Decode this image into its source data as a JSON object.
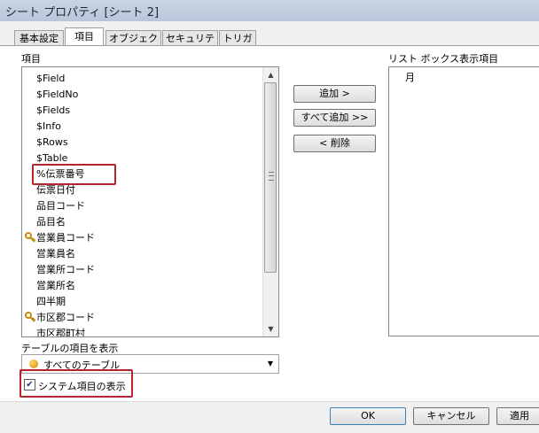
{
  "window": {
    "title": "シート プロパティ [シート 2]"
  },
  "tabs": [
    {
      "label": "基本設定",
      "active": false
    },
    {
      "label": "項目",
      "active": true
    },
    {
      "label": "オブジェクト",
      "active": false
    },
    {
      "label": "セキュリティ",
      "active": false
    },
    {
      "label": "トリガー",
      "active": false
    }
  ],
  "fields_panel": {
    "label": "項目",
    "items": [
      {
        "text": "$Field",
        "icon": ""
      },
      {
        "text": "$FieldNo",
        "icon": ""
      },
      {
        "text": "$Fields",
        "icon": ""
      },
      {
        "text": "$Info",
        "icon": ""
      },
      {
        "text": "$Rows",
        "icon": ""
      },
      {
        "text": "$Table",
        "icon": ""
      },
      {
        "text": "%伝票番号",
        "icon": ""
      },
      {
        "text": "伝票日付",
        "icon": ""
      },
      {
        "text": "品目コード",
        "icon": ""
      },
      {
        "text": "品目名",
        "icon": ""
      },
      {
        "text": "営業員コード",
        "icon": "key-icon"
      },
      {
        "text": "営業員名",
        "icon": ""
      },
      {
        "text": "営業所コード",
        "icon": ""
      },
      {
        "text": "営業所名",
        "icon": ""
      },
      {
        "text": "四半期",
        "icon": ""
      },
      {
        "text": "市区郡コード",
        "icon": "key-icon"
      },
      {
        "text": "市区郡町村",
        "icon": ""
      }
    ]
  },
  "buttons": {
    "add": "追加 >",
    "add_all": "すべて追加 >>",
    "remove": "< 削除"
  },
  "listbox_panel": {
    "label": "リスト ボックス表示項目",
    "items": [
      "月"
    ]
  },
  "table_filter": {
    "label": "テーブルの項目を表示",
    "selected": "すべてのテーブル"
  },
  "system_fields": {
    "label": "システム項目の表示",
    "checked": true
  },
  "footer": {
    "ok": "OK",
    "cancel": "キャンセル",
    "apply": "適用"
  },
  "colors": {
    "highlight_border": "#b4262b",
    "key_icon": "#c48a10"
  }
}
